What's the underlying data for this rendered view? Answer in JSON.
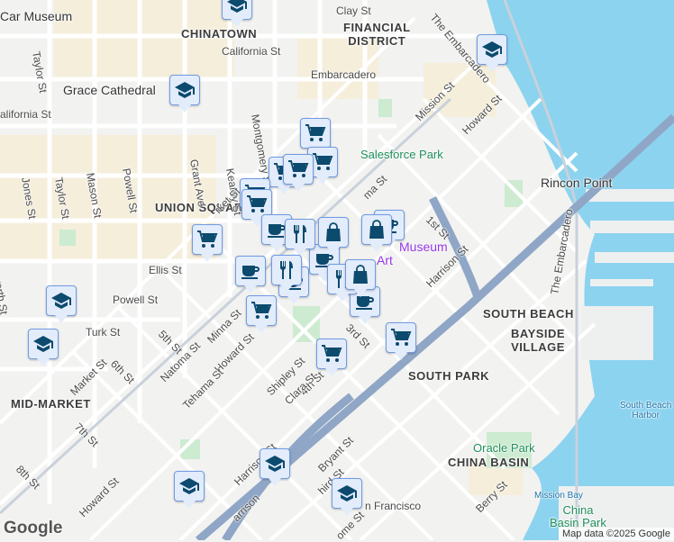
{
  "areas": {
    "chinatown": "CHINATOWN",
    "financial": "FINANCIAL\nDISTRICT",
    "union": "UNION SQUARE",
    "southbeach": "SOUTH BEACH",
    "bayside": "BAYSIDE\nVILLAGE",
    "southpark": "SOUTH PARK",
    "midmarket": "MID-MARKET",
    "chinabasin": "CHINA BASIN",
    "rincon": "Rincon Point"
  },
  "pois": {
    "carmuseum": "Car Museum",
    "grace": "Grace Cathedral",
    "salesforce": "Salesforce Park",
    "embarcadero": "Embarcadero",
    "museum": "Museum",
    "art": "Art",
    "oracle": "Oracle Park",
    "harbor": "South Beach\nHarbor",
    "cbpark": "China\nBasin Park",
    "missionbay": "Mission Bay",
    "sf": "n Francisco",
    "powell": "Powell St"
  },
  "streets": [
    "Clay St",
    "The Embarcadero",
    "Taylor St",
    "California St",
    "Mission St",
    "Howard St",
    "alifornia St",
    "Montgomery St",
    "Kearny St",
    "Grant Ave",
    "Powell St",
    "Mason St",
    "Taylor St",
    "Jones St",
    "Leavenworth St",
    "1st St",
    "Harrison St",
    "Ellis St",
    "Turk St",
    "5th St",
    "Minna St",
    "Howard St",
    "3rd St",
    "4th St",
    "Market St",
    "6th St",
    "Natoma St",
    "Tehama St",
    "Shipley St",
    "Clara St",
    "7th St",
    "8th St",
    "Bryant St",
    "Harrison St",
    "Berry St",
    "The Embarcadero",
    "Howard St",
    "rket St",
    "ma St",
    "arrison",
    "hird St",
    "ome St",
    "Mission St"
  ],
  "markers": [
    "school",
    "school",
    "school",
    "school",
    "school",
    "school",
    "school",
    "school",
    "cart",
    "cart",
    "cart",
    "cart",
    "cart",
    "cart",
    "cart",
    "cart",
    "cart",
    "cart",
    "cup",
    "cup",
    "cup",
    "cup",
    "cup",
    "cup",
    "fork",
    "fork",
    "fork",
    "bag",
    "bag",
    "bag"
  ],
  "attribution": "Map data ©2025 Google",
  "logo": "Google"
}
